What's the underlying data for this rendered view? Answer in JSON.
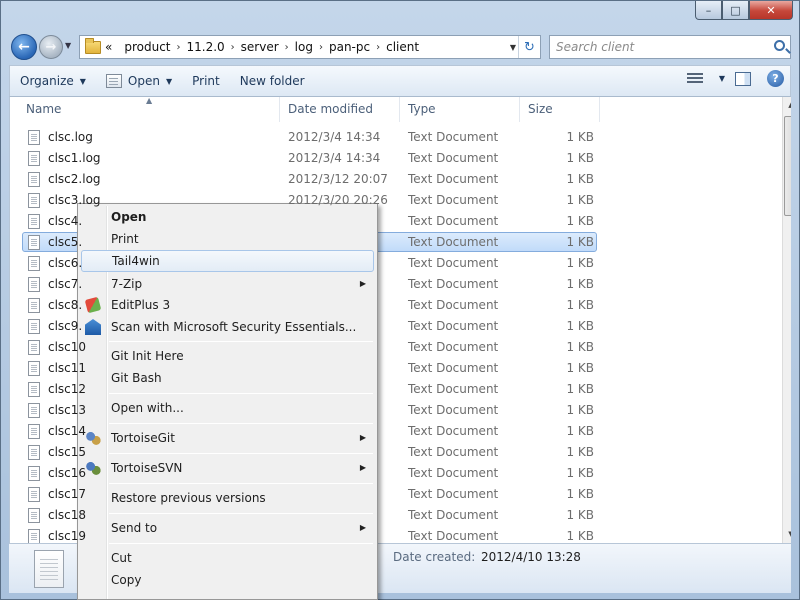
{
  "window": {
    "title": "",
    "minimize": "–",
    "maximize": "□",
    "close": "✕"
  },
  "address": {
    "chevron": "«",
    "crumbs": [
      "product",
      "11.2.0",
      "server",
      "log",
      "pan-pc",
      "client"
    ],
    "separator": "›"
  },
  "search": {
    "placeholder": "Search client"
  },
  "toolbar": {
    "organize": "Organize",
    "open": "Open",
    "print": "Print",
    "new_folder": "New folder"
  },
  "columns": {
    "name": "Name",
    "date": "Date modified",
    "type": "Type",
    "size": "Size"
  },
  "files": [
    {
      "name": "clsc.log",
      "date": "2012/3/4 14:34",
      "type": "Text Document",
      "size": "1 KB"
    },
    {
      "name": "clsc1.log",
      "date": "2012/3/4 14:34",
      "type": "Text Document",
      "size": "1 KB"
    },
    {
      "name": "clsc2.log",
      "date": "2012/3/12 20:07",
      "type": "Text Document",
      "size": "1 KB"
    },
    {
      "name": "clsc3.log",
      "date": "2012/3/20 20:26",
      "type": "Text Document",
      "size": "1 KB"
    },
    {
      "name": "clsc4.",
      "date": "",
      "type": "Text Document",
      "size": "1 KB"
    },
    {
      "name": "clsc5.",
      "date": "",
      "type": "Text Document",
      "size": "1 KB"
    },
    {
      "name": "clsc6.",
      "date": "",
      "type": "Text Document",
      "size": "1 KB"
    },
    {
      "name": "clsc7.",
      "date": "",
      "type": "Text Document",
      "size": "1 KB"
    },
    {
      "name": "clsc8.",
      "date": "",
      "type": "Text Document",
      "size": "1 KB"
    },
    {
      "name": "clsc9.",
      "date": "",
      "type": "Text Document",
      "size": "1 KB"
    },
    {
      "name": "clsc10",
      "date": "",
      "type": "Text Document",
      "size": "1 KB"
    },
    {
      "name": "clsc11",
      "date": "",
      "type": "Text Document",
      "size": "1 KB"
    },
    {
      "name": "clsc12",
      "date": "",
      "type": "Text Document",
      "size": "1 KB"
    },
    {
      "name": "clsc13",
      "date": "",
      "type": "Text Document",
      "size": "1 KB"
    },
    {
      "name": "clsc14",
      "date": "",
      "type": "Text Document",
      "size": "1 KB"
    },
    {
      "name": "clsc15",
      "date": "",
      "type": "Text Document",
      "size": "1 KB"
    },
    {
      "name": "clsc16",
      "date": "",
      "type": "Text Document",
      "size": "1 KB"
    },
    {
      "name": "clsc17",
      "date": "",
      "type": "Text Document",
      "size": "1 KB"
    },
    {
      "name": "clsc18",
      "date": "",
      "type": "Text Document",
      "size": "1 KB"
    },
    {
      "name": "clsc19",
      "date": "",
      "type": "Text Document",
      "size": "1 KB"
    }
  ],
  "selected_index": 5,
  "details": {
    "label": "Date created:",
    "value": "2012/4/10 13:28"
  },
  "context_menu": {
    "open": "Open",
    "print": "Print",
    "tail4win": "Tail4win",
    "seven_zip": "7-Zip",
    "editplus": "EditPlus 3",
    "scan": "Scan with Microsoft Security Essentials...",
    "git_init": "Git Init Here",
    "git_bash": "Git Bash",
    "open_with": "Open with...",
    "tortoisegit": "TortoiseGit",
    "tortoisesvn": "TortoiseSVN",
    "restore": "Restore previous versions",
    "send_to": "Send to",
    "cut": "Cut",
    "copy": "Copy"
  }
}
